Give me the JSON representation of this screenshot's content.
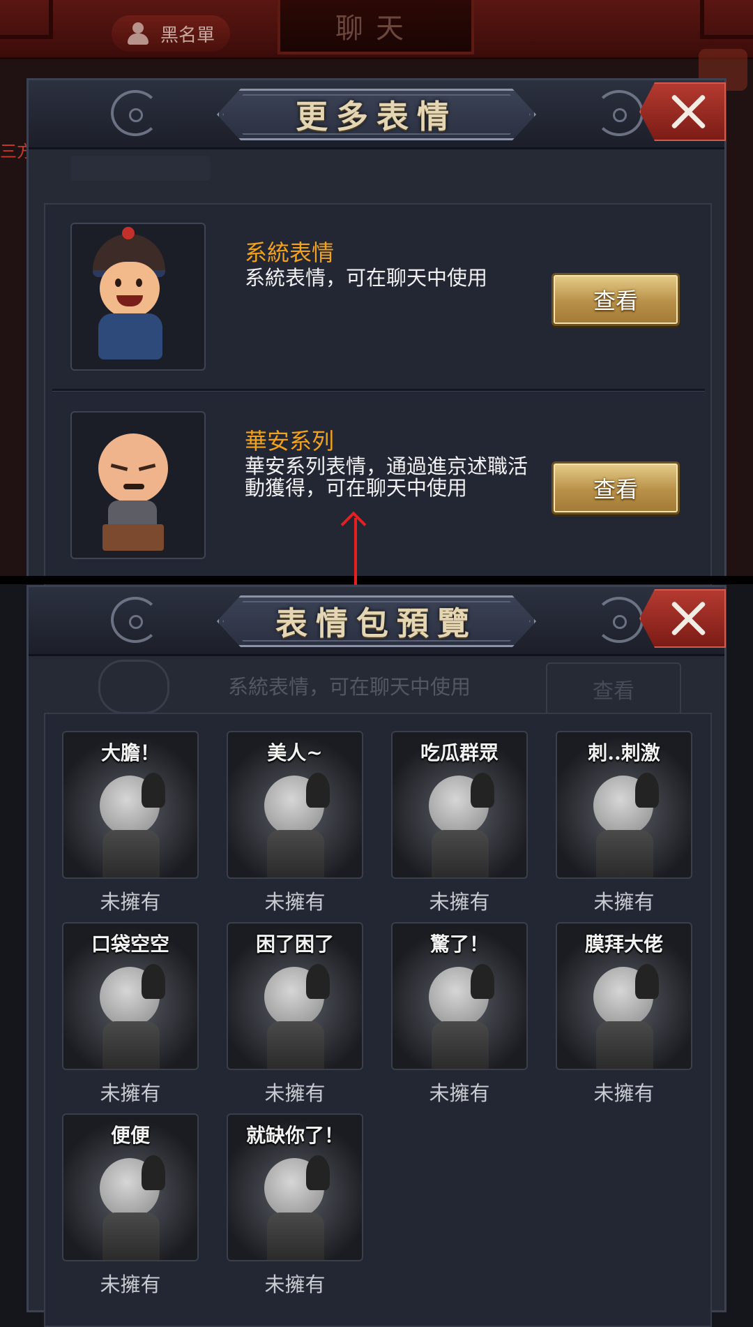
{
  "top_bar": {
    "blacklist_label": "黑名單",
    "chat_title": "聊天",
    "left_partial_text": "三方"
  },
  "more_panel": {
    "title": "更多表情",
    "packs": [
      {
        "name": "系統表情",
        "description": "系統表情，可在聊天中使用",
        "button_label": "查看"
      },
      {
        "name": "華安系列",
        "description": "華安系列表情，通過進京述職活動獲得，可在聊天中使用",
        "button_label": "查看"
      }
    ]
  },
  "preview_panel": {
    "title": "表情包預覽",
    "ghost_description": "系統表情，可在聊天中使用",
    "ghost_button": "查看",
    "stickers": [
      {
        "caption": "大膽！",
        "status": "未擁有"
      },
      {
        "caption": "美人~",
        "status": "未擁有"
      },
      {
        "caption": "吃瓜群眾",
        "status": "未擁有"
      },
      {
        "caption": "刺..刺激",
        "status": "未擁有"
      },
      {
        "caption": "口袋空空",
        "status": "未擁有"
      },
      {
        "caption": "困了困了",
        "status": "未擁有"
      },
      {
        "caption": "驚了！",
        "status": "未擁有"
      },
      {
        "caption": "膜拜大佬",
        "status": "未擁有"
      },
      {
        "caption": "便便",
        "status": "未擁有"
      },
      {
        "caption": "就缺你了！",
        "status": "未擁有"
      }
    ]
  },
  "colors": {
    "pack_name": "#f3a21c",
    "close_button": "#b43a30",
    "view_button": "#d4b46a",
    "arrow": "#e42020"
  },
  "icons": {
    "close": "close-icon",
    "blacklist": "people-icon",
    "arrow": "arrow-up-icon"
  }
}
